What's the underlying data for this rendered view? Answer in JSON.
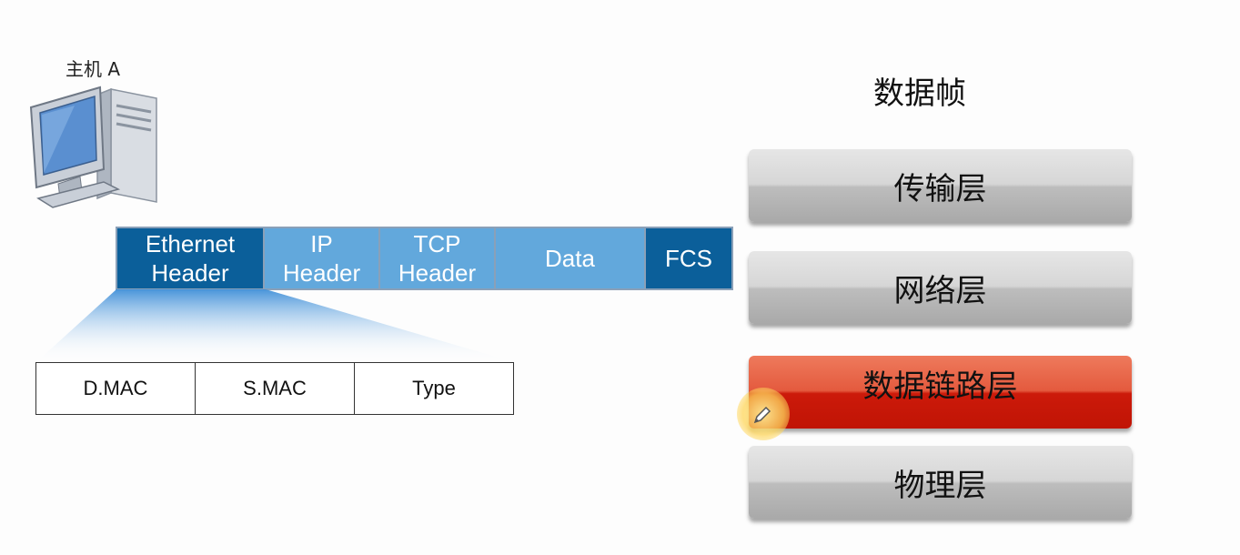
{
  "host": {
    "label": "主机 A"
  },
  "frame": {
    "segments": [
      {
        "line1": "Ethernet",
        "line2": "Header"
      },
      {
        "line1": "IP",
        "line2": "Header"
      },
      {
        "line1": "TCP",
        "line2": "Header"
      },
      {
        "line1": "Data"
      },
      {
        "line1": "FCS"
      }
    ]
  },
  "header_fields": [
    "D.MAC",
    "S.MAC",
    "Type"
  ],
  "stack": {
    "title": "数据帧",
    "layers": [
      "传输层",
      "网络层",
      "数据链路层",
      "物理层"
    ],
    "active_layer": "数据链路层"
  },
  "colors": {
    "frame_dark": "#0b5f9a",
    "frame_light": "#62a8dc",
    "layer_gray": "#bdbdbd",
    "layer_active": "#cc1a0a"
  }
}
